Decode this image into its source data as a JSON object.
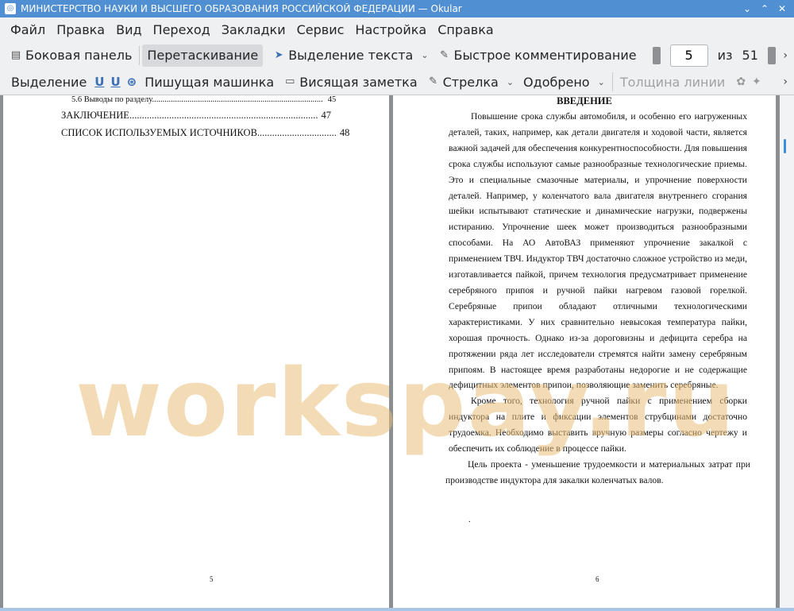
{
  "window": {
    "title": "МИНИСТЕРСТВО НАУКИ И ВЫСШЕГО ОБРАЗОВАНИЯ  РОССИЙСКОЙ ФЕДЕРАЦИИ  — Okular",
    "buttons": {
      "minimize": "⌄",
      "maximize": "⌃",
      "close": "✕"
    }
  },
  "menubar": [
    "Файл",
    "Правка",
    "Вид",
    "Переход",
    "Закладки",
    "Сервис",
    "Настройка",
    "Справка"
  ],
  "toolbar1": {
    "sidebar": "Боковая панель",
    "drag": "Перетаскивание",
    "text_select": "Выделение текста",
    "quick_annotate": "Быстрое комментирование",
    "page_current": "5",
    "page_of": "из",
    "page_total": "51",
    "overflow": "›"
  },
  "toolbar2": {
    "selection": "Выделение",
    "typewriter": "Пишущая машинка",
    "pop_note": "Висящая заметка",
    "arrow": "Стрелка",
    "stamp": "Одобрено",
    "line_width": "Толщина линии",
    "overflow": "›"
  },
  "left_page": {
    "toc": [
      {
        "label": "5.6 Выводы по разделу",
        "page": "45"
      },
      {
        "label": "ЗАКЛЮЧЕНИЕ",
        "page": "47"
      },
      {
        "label": "СПИСОК ИСПОЛЬЗУЕМЫХ ИСТОЧНИКОВ",
        "page": "48"
      }
    ],
    "page_number": "5"
  },
  "right_page": {
    "heading": "ВВЕДЕНИЕ",
    "paragraphs": [
      "Повышение срока службы автомобиля, и особенно его нагруженных деталей, таких, например, как детали двигателя и ходовой части, является важной задачей для обеспечения конкурентноспособности. Для повышения срока службы используют самые разнообразные технологические приемы. Это и специальные смазочные материалы, и упрочнение поверхности деталей. Например, у коленчатого вала двигателя внутреннего сгорания шейки испытывают статические и динамические нагрузки, подвержены истиранию. Упрочнение шеек может производиться разнообразными способами. На АО АвтоВАЗ применяют упрочнение закалкой с применением ТВЧ. Индуктор ТВЧ достаточно сложное устройство из меди, изготавливается пайкой, причем технология предусматривает применение серебряного припоя и ручной пайки нагревом газовой горелкой. Серебряные припои обладают отличными технологическими характеристиками. У них сравнительно невысокая температура пайки, хорошая прочность. Однако из-за дороговизны и дефицита серебра на протяжении ряда лет исследователи стремятся найти замену серебряным припоям. В настоящее время разработаны недорогие и не содержащие дефицитных элементов припои, позволяющие заменить серебряные.",
      "Кроме того, технология ручной пайки с применением сборки индуктора на плите и фиксации элементов струбцинами достаточно трудоемка. Необходимо выставить вручную размеры согласно чертежу и обеспечить их соблюдение в процессе пайки.",
      "Цель проекта - уменьшение трудоемкости и материальных затрат при производстве индуктора для закалки коленчатых валов."
    ],
    "stray_mark": ".",
    "page_number": "6"
  },
  "watermark": "workspay.ru"
}
